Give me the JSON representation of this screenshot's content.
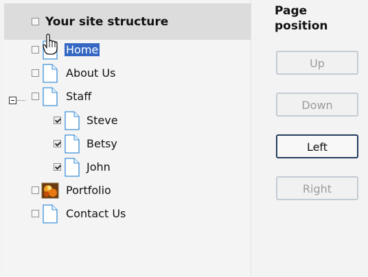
{
  "tree": {
    "header": {
      "title": "Your site structure",
      "checked": false
    },
    "items": [
      {
        "label": "Home",
        "checked": false,
        "selected": true,
        "icon": "page-icon"
      },
      {
        "label": "About Us",
        "checked": false,
        "selected": false,
        "icon": "page-icon"
      },
      {
        "label": "Staff",
        "checked": false,
        "selected": false,
        "icon": "page-icon",
        "expanded": true
      },
      {
        "label": "Steve",
        "checked": true,
        "selected": false,
        "icon": "page-icon"
      },
      {
        "label": "Betsy",
        "checked": true,
        "selected": false,
        "icon": "page-icon"
      },
      {
        "label": "John",
        "checked": true,
        "selected": false,
        "icon": "page-icon"
      },
      {
        "label": "Portfolio",
        "checked": false,
        "selected": false,
        "icon": "image-icon"
      },
      {
        "label": "Contact Us",
        "checked": false,
        "selected": false,
        "icon": "page-icon"
      }
    ]
  },
  "position_panel": {
    "heading_line1": "Page",
    "heading_line2": "position",
    "buttons": {
      "up": {
        "label": "Up",
        "enabled": false
      },
      "down": {
        "label": "Down",
        "enabled": false
      },
      "left": {
        "label": "Left",
        "enabled": true
      },
      "right": {
        "label": "Right",
        "enabled": false
      }
    }
  },
  "colors": {
    "selection": "#3468c3",
    "header_bg": "#dcdcdc",
    "button_border_enabled": "#233b5e",
    "button_border_disabled": "#c3cbd3"
  }
}
